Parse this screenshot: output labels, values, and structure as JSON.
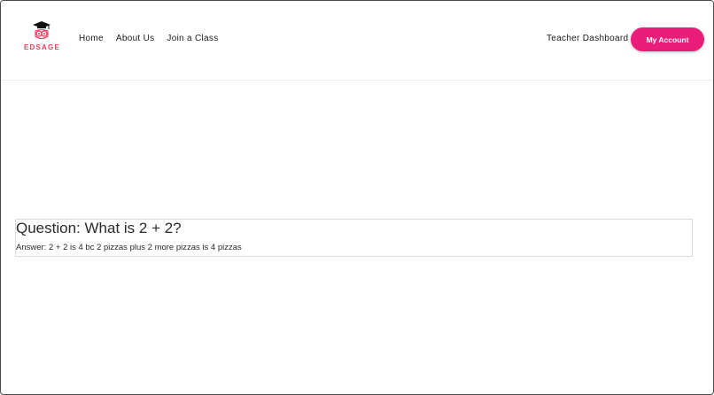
{
  "header": {
    "logo_text": "EDSAGE",
    "nav": {
      "home": "Home",
      "about": "About Us",
      "join": "Join a Class"
    },
    "teacher_dashboard": "Teacher Dashboard",
    "my_account": "My Account"
  },
  "card": {
    "question": "Question: What is 2 + 2?",
    "answer": "Answer: 2 + 2 is 4 bc 2 pizzas plus 2 more pizzas is 4 pizzas"
  },
  "colors": {
    "brand_pink": "#ea1e7a",
    "logo_red": "#e83e5c"
  },
  "icons": {
    "logo": "owl-graduation-cap-icon"
  }
}
